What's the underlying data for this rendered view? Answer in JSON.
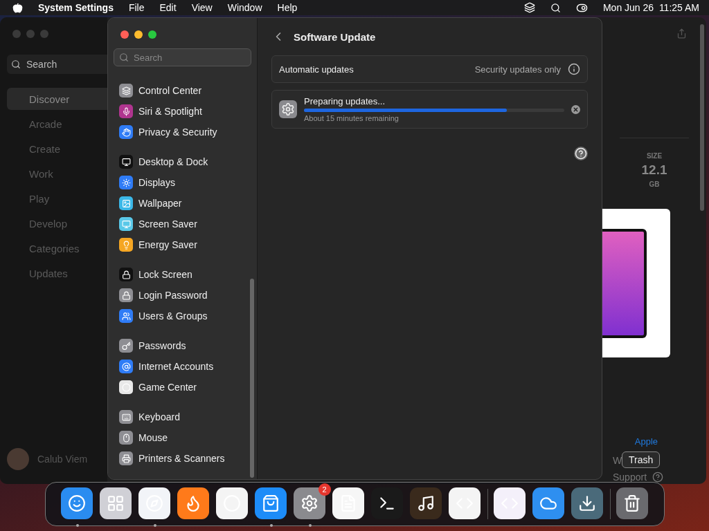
{
  "menu_bar": {
    "app_name": "System Settings",
    "menus": [
      "File",
      "Edit",
      "View",
      "Window",
      "Help"
    ],
    "clock": "Mon Jun 26  11:25 AM"
  },
  "background_window": {
    "search": {
      "placeholder": "Search"
    },
    "nav": [
      {
        "label": "Discover",
        "selected": true
      },
      {
        "label": "Arcade",
        "selected": false
      },
      {
        "label": "Create",
        "selected": false
      },
      {
        "label": "Work",
        "selected": false
      },
      {
        "label": "Play",
        "selected": false
      },
      {
        "label": "Develop",
        "selected": false
      },
      {
        "label": "Categories",
        "selected": false
      },
      {
        "label": "Updates",
        "selected": false
      }
    ],
    "user_name": "Calub Viem",
    "size_label": "SIZE",
    "size_value": "12.1",
    "size_unit": "GB",
    "link": "Apple",
    "footer_cut": "W",
    "support": "Support"
  },
  "settings_window": {
    "search": {
      "placeholder": "Search"
    },
    "sidebar": [
      [
        {
          "label": "Control Center",
          "color": "#8e8e93"
        },
        {
          "label": "Siri & Spotlight",
          "color": "#b0358f"
        },
        {
          "label": "Privacy & Security",
          "color": "#2f7cf6"
        }
      ],
      [
        {
          "label": "Desktop & Dock",
          "color": "#111111"
        },
        {
          "label": "Displays",
          "color": "#2f7cf6"
        },
        {
          "label": "Wallpaper",
          "color": "#3bb8e8"
        },
        {
          "label": "Screen Saver",
          "color": "#5ac8e8"
        },
        {
          "label": "Energy Saver",
          "color": "#f5a623"
        }
      ],
      [
        {
          "label": "Lock Screen",
          "color": "#111111"
        },
        {
          "label": "Login Password",
          "color": "#8e8e93"
        },
        {
          "label": "Users & Groups",
          "color": "#2f7cf6"
        }
      ],
      [
        {
          "label": "Passwords",
          "color": "#8e8e93"
        },
        {
          "label": "Internet Accounts",
          "color": "#2f7cf6"
        },
        {
          "label": "Game Center",
          "color": "#e8e8e8"
        }
      ],
      [
        {
          "label": "Keyboard",
          "color": "#8e8e93"
        },
        {
          "label": "Mouse",
          "color": "#8e8e93"
        },
        {
          "label": "Printers & Scanners",
          "color": "#8e8e93"
        }
      ]
    ],
    "title": "Software Update",
    "automatic_updates": {
      "label": "Automatic updates",
      "value": "Security updates only"
    },
    "update": {
      "title": "Preparing updates...",
      "level": 0.78,
      "remaining": "About 15 minutes remaining"
    }
  },
  "dock": [
    {
      "kind": "finder",
      "color": "#2a8cf0",
      "running": true
    },
    {
      "kind": "grid",
      "color": "#d0d0d6",
      "running": false
    },
    {
      "kind": "compass",
      "color": "#f2f4f8",
      "running": true
    },
    {
      "kind": "fox",
      "color": "#ff7a1a",
      "running": false
    },
    {
      "kind": "chrome",
      "color": "#f4f4f4",
      "running": false
    },
    {
      "kind": "store",
      "color": "#1d8cf8",
      "running": true
    },
    {
      "kind": "gear",
      "color": "#8a8a8e",
      "running": true,
      "badge": "2"
    },
    {
      "kind": "notepad",
      "color": "#f6f6f6",
      "running": false
    },
    {
      "kind": "terminal",
      "color": "#1a1a1a",
      "running": false
    },
    {
      "kind": "guitar",
      "color": "#3a2a1c",
      "running": false
    },
    {
      "kind": "code",
      "color": "#f4f4f4",
      "running": false
    },
    {
      "kind": "separator"
    },
    {
      "kind": "studio",
      "color": "#f4f0fa",
      "running": false
    },
    {
      "kind": "weather",
      "color": "#2e8ff0",
      "running": false
    },
    {
      "kind": "installer",
      "color": "#4a6a7a",
      "running": false
    },
    {
      "kind": "separator"
    },
    {
      "kind": "trash",
      "color": "#6a6a6e",
      "running": false
    }
  ],
  "tooltip": "Trash"
}
